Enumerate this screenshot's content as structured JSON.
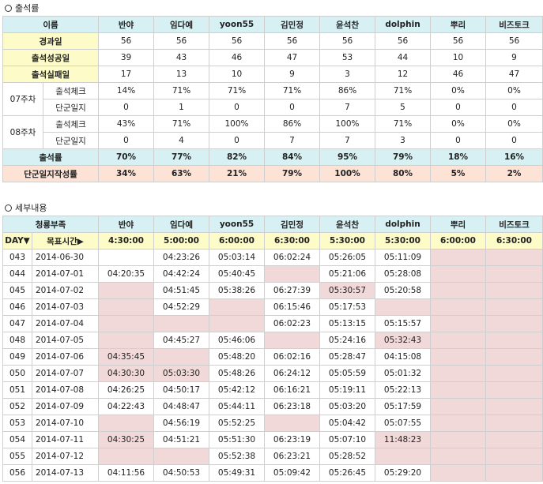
{
  "section1": {
    "title": "출석률"
  },
  "section2": {
    "title": "세부내용"
  },
  "members": [
    "반야",
    "임다예",
    "yoon55",
    "김민정",
    "윤석찬",
    "dolphin",
    "뿌리",
    "비즈토크"
  ],
  "summary": {
    "name_header": "이름",
    "rows": [
      {
        "label": "경과일",
        "values": [
          "56",
          "56",
          "56",
          "56",
          "56",
          "56",
          "56",
          "56"
        ]
      },
      {
        "label": "출석성공일",
        "values": [
          "39",
          "43",
          "46",
          "47",
          "53",
          "44",
          "10",
          "9"
        ]
      },
      {
        "label": "출석실패일",
        "values": [
          "17",
          "13",
          "10",
          "9",
          "3",
          "12",
          "46",
          "47"
        ]
      }
    ],
    "weeks": [
      {
        "week": "07주차",
        "rows": [
          {
            "label": "출석체크",
            "values": [
              "14%",
              "71%",
              "71%",
              "71%",
              "86%",
              "71%",
              "0%",
              "0%"
            ]
          },
          {
            "label": "단군일지",
            "values": [
              "0",
              "1",
              "0",
              "0",
              "7",
              "5",
              "0",
              "0"
            ]
          }
        ]
      },
      {
        "week": "08주차",
        "rows": [
          {
            "label": "출석체크",
            "values": [
              "43%",
              "71%",
              "100%",
              "86%",
              "100%",
              "71%",
              "0%",
              "0%"
            ]
          },
          {
            "label": "단군일지",
            "values": [
              "0",
              "4",
              "0",
              "7",
              "7",
              "3",
              "0",
              "0"
            ]
          }
        ]
      }
    ],
    "attendance_rate": {
      "label": "출석률",
      "values": [
        "70%",
        "77%",
        "82%",
        "84%",
        "95%",
        "79%",
        "18%",
        "16%"
      ]
    },
    "journal_rate": {
      "label": "단군일지작성률",
      "values": [
        "34%",
        "63%",
        "21%",
        "79%",
        "100%",
        "80%",
        "5%",
        "2%"
      ]
    }
  },
  "detail": {
    "header_label": "청룡부족",
    "day_label": "DAY▼",
    "target_label": "목표시간▶",
    "targets": [
      "4:30:00",
      "5:00:00",
      "6:00:00",
      "6:30:00",
      "5:30:00",
      "5:30:00",
      "6:00:00",
      "6:30:00"
    ],
    "rows": [
      {
        "day": "043",
        "date": "2014-06-30",
        "times": [
          "",
          "04:23:26",
          "05:03:14",
          "06:02:24",
          "05:26:05",
          "05:11:09",
          "",
          ""
        ]
      },
      {
        "day": "044",
        "date": "2014-07-01",
        "times": [
          "04:20:35",
          "04:42:24",
          "05:40:45",
          "",
          "05:21:06",
          "05:28:08",
          "",
          ""
        ]
      },
      {
        "day": "045",
        "date": "2014-07-02",
        "times": [
          "",
          "04:51:45",
          "05:38:26",
          "06:27:39",
          "05:30:57",
          "05:20:58",
          "",
          ""
        ]
      },
      {
        "day": "046",
        "date": "2014-07-03",
        "times": [
          "",
          "04:52:29",
          "",
          "06:15:46",
          "05:17:53",
          "",
          "",
          ""
        ]
      },
      {
        "day": "047",
        "date": "2014-07-04",
        "times": [
          "",
          "",
          "",
          "06:02:23",
          "05:13:15",
          "05:15:57",
          "",
          ""
        ]
      },
      {
        "day": "048",
        "date": "2014-07-05",
        "times": [
          "",
          "04:45:27",
          "05:46:06",
          "",
          "05:24:16",
          "05:32:43",
          "",
          ""
        ]
      },
      {
        "day": "049",
        "date": "2014-07-06",
        "times": [
          "04:35:45",
          "",
          "05:48:20",
          "06:02:16",
          "05:28:47",
          "04:15:08",
          "",
          ""
        ]
      },
      {
        "day": "050",
        "date": "2014-07-07",
        "times": [
          "04:30:30",
          "05:03:30",
          "05:48:26",
          "06:24:12",
          "05:05:59",
          "05:01:32",
          "",
          ""
        ]
      },
      {
        "day": "051",
        "date": "2014-07-08",
        "times": [
          "04:26:25",
          "04:50:17",
          "05:42:12",
          "06:16:21",
          "05:19:11",
          "05:22:13",
          "",
          ""
        ]
      },
      {
        "day": "052",
        "date": "2014-07-09",
        "times": [
          "04:22:43",
          "04:48:47",
          "05:44:11",
          "06:23:18",
          "05:03:20",
          "05:17:59",
          "",
          ""
        ]
      },
      {
        "day": "053",
        "date": "2014-07-10",
        "times": [
          "",
          "04:56:19",
          "05:52:25",
          "",
          "05:04:42",
          "05:07:55",
          "",
          ""
        ]
      },
      {
        "day": "054",
        "date": "2014-07-11",
        "times": [
          "04:30:25",
          "04:51:21",
          "05:51:30",
          "06:23:19",
          "05:07:10",
          "11:48:23",
          "",
          ""
        ]
      },
      {
        "day": "055",
        "date": "2014-07-12",
        "times": [
          "",
          "",
          "05:52:38",
          "06:23:21",
          "05:28:52",
          "",
          "",
          ""
        ]
      },
      {
        "day": "056",
        "date": "2014-07-13",
        "times": [
          "04:11:56",
          "04:50:53",
          "05:49:31",
          "05:09:42",
          "05:26:45",
          "05:29:20",
          "",
          ""
        ]
      }
    ],
    "pink_cells": [
      [
        0,
        6
      ],
      [
        0,
        7
      ],
      [
        1,
        3
      ],
      [
        1,
        6
      ],
      [
        1,
        7
      ],
      [
        2,
        0
      ],
      [
        2,
        4
      ],
      [
        2,
        6
      ],
      [
        2,
        7
      ],
      [
        3,
        0
      ],
      [
        3,
        2
      ],
      [
        3,
        5
      ],
      [
        3,
        6
      ],
      [
        3,
        7
      ],
      [
        4,
        0
      ],
      [
        4,
        1
      ],
      [
        4,
        2
      ],
      [
        4,
        6
      ],
      [
        4,
        7
      ],
      [
        5,
        0
      ],
      [
        5,
        3
      ],
      [
        5,
        5
      ],
      [
        5,
        6
      ],
      [
        5,
        7
      ],
      [
        6,
        0
      ],
      [
        6,
        1
      ],
      [
        6,
        6
      ],
      [
        6,
        7
      ],
      [
        7,
        0
      ],
      [
        7,
        1
      ],
      [
        7,
        6
      ],
      [
        7,
        7
      ],
      [
        8,
        6
      ],
      [
        8,
        7
      ],
      [
        9,
        6
      ],
      [
        9,
        7
      ],
      [
        10,
        0
      ],
      [
        10,
        3
      ],
      [
        10,
        6
      ],
      [
        10,
        7
      ],
      [
        11,
        0
      ],
      [
        11,
        5
      ],
      [
        11,
        6
      ],
      [
        11,
        7
      ],
      [
        12,
        0
      ],
      [
        12,
        1
      ],
      [
        12,
        5
      ],
      [
        12,
        6
      ],
      [
        12,
        7
      ],
      [
        13,
        6
      ],
      [
        13,
        7
      ]
    ]
  }
}
